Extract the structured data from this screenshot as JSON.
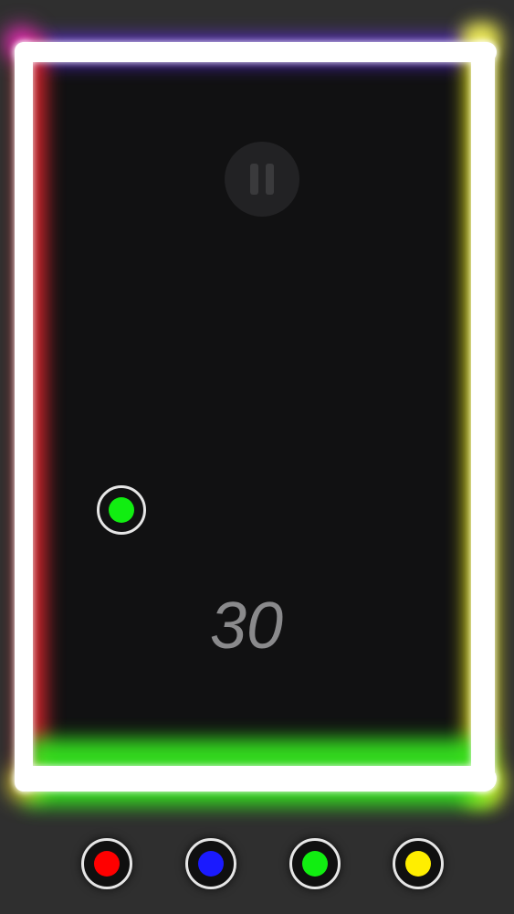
{
  "game": {
    "score": "30",
    "frame_colors": {
      "top": "#5b2bd6",
      "left": "#e0262d",
      "right": "#f2f21e",
      "bottom": "#35e31f",
      "corner_top_left": "#ff2fd2",
      "corner_top_right": "#f7f27a",
      "corner_bottom_left": "#f1ef3a",
      "corner_bottom_right": "#d6f53a"
    },
    "ball": {
      "color": "#11ee11"
    },
    "pause": {
      "icon": "pause-icon"
    }
  },
  "color_buttons": [
    {
      "name": "red",
      "color": "#ff0000"
    },
    {
      "name": "blue",
      "color": "#1a1aff"
    },
    {
      "name": "green",
      "color": "#11ee11"
    },
    {
      "name": "yellow",
      "color": "#ffee00"
    }
  ]
}
